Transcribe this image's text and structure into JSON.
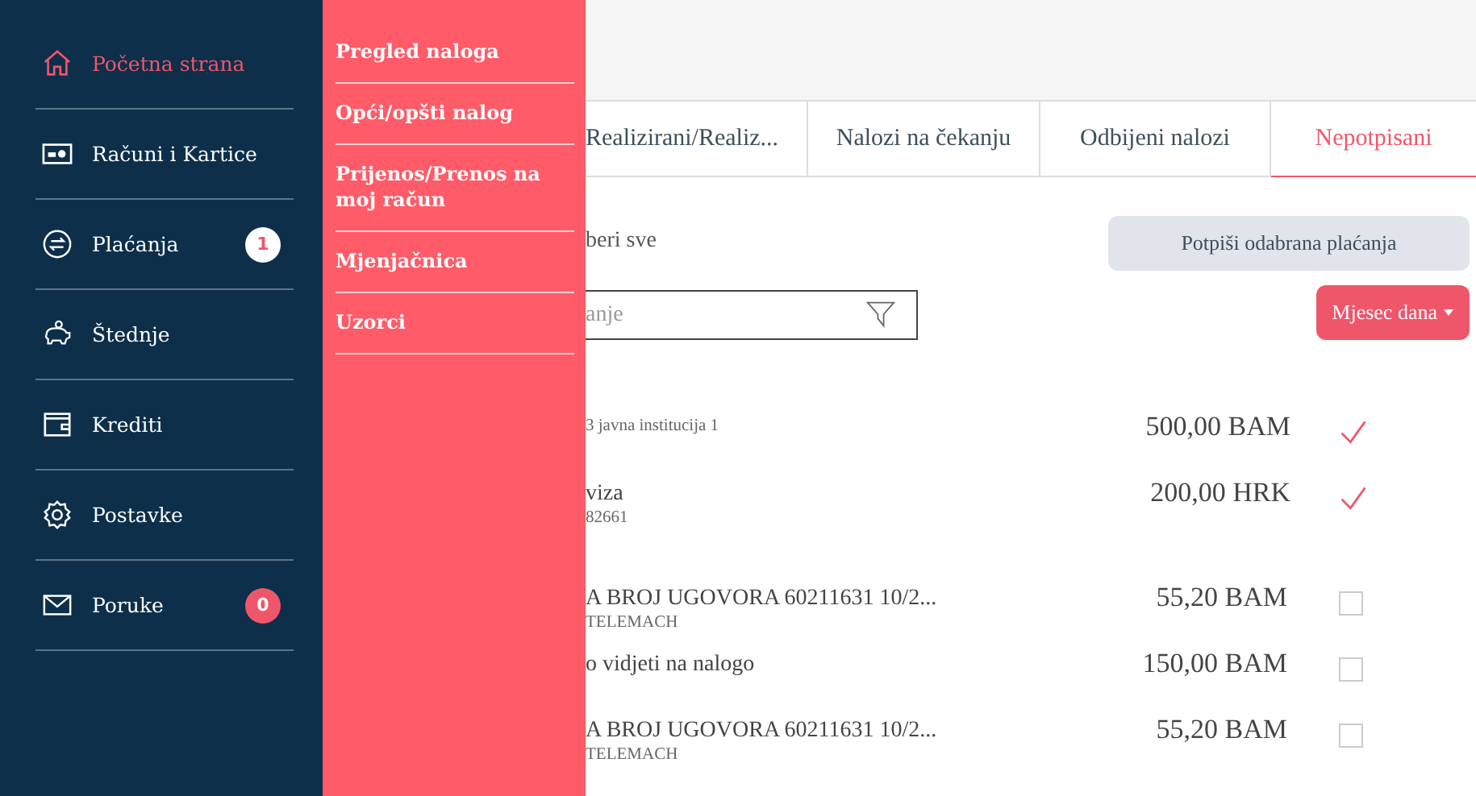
{
  "sidebar": {
    "items": [
      {
        "label": "Početna strana",
        "kind": "home",
        "selected": true
      },
      {
        "label": "Računi i Kartice",
        "kind": "card",
        "selected": false
      },
      {
        "label": "Plaćanja",
        "kind": "transfer",
        "selected": false,
        "badge": "1",
        "color": "#ffffff"
      },
      {
        "label": "Štednje",
        "kind": "piggy",
        "selected": false
      },
      {
        "label": "Krediti",
        "kind": "wallet",
        "selected": false
      },
      {
        "label": "Postavke",
        "kind": "gear",
        "selected": false
      },
      {
        "label": "Poruke",
        "kind": "mail",
        "selected": false,
        "badge": "0",
        "color": "#f0566a"
      }
    ]
  },
  "submenu": {
    "items": [
      "Pregled naloga",
      "Opći/opšti nalog",
      "Prijenos/Prenos na moj račun",
      "Mjenjačnica",
      "Uzorci"
    ]
  },
  "tabs": [
    {
      "label": "Realizirani/Realiz...",
      "selected": false
    },
    {
      "label": "Nalozi na čekanju",
      "selected": false
    },
    {
      "label": "Odbijeni nalozi",
      "selected": false
    },
    {
      "label": "Nepotpisani",
      "selected": true
    }
  ],
  "select_all_label": "beri sve",
  "sign_button": "Potpiši odabrana plaćanja",
  "search": {
    "placeholder": "anje"
  },
  "period_button": "Mjesec dana",
  "groups": [
    {
      "rows": [
        {
          "sub": "3 javna institucija 1",
          "amount": "500,00 BAM",
          "checked": true
        },
        {
          "name": "viza",
          "sub": "82661",
          "amount": "200,00 HRK",
          "checked": true
        }
      ]
    },
    {
      "rows": [
        {
          "name": "A BROJ UGOVORA 60211631 10/2...",
          "sub": "TELEMACH",
          "amount": "55,20 BAM",
          "checked": false
        },
        {
          "name": "o vidjeti na nalogo",
          "amount": "150,00 BAM",
          "checked": false
        },
        {
          "name": "A BROJ UGOVORA 60211631 10/2...",
          "sub": "TELEMACH",
          "amount": "55,20 BAM",
          "checked": false
        }
      ]
    }
  ]
}
